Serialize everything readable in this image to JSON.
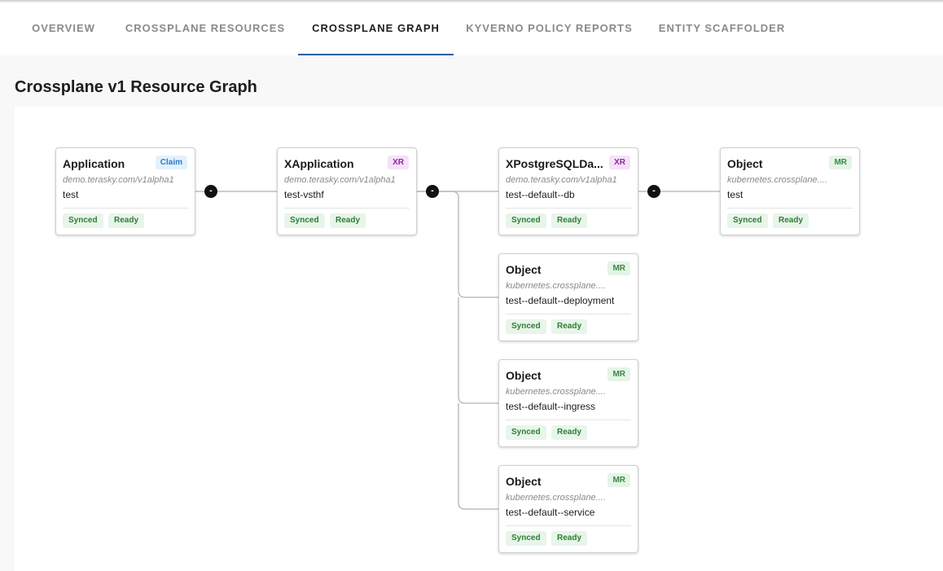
{
  "tabs": [
    {
      "label": "OVERVIEW",
      "active": false
    },
    {
      "label": "CROSSPLANE RESOURCES",
      "active": false
    },
    {
      "label": "CROSSPLANE GRAPH",
      "active": true
    },
    {
      "label": "KYVERNO POLICY REPORTS",
      "active": false
    },
    {
      "label": "ENTITY SCAFFOLDER",
      "active": false
    }
  ],
  "page": {
    "title": "Crossplane v1 Resource Graph"
  },
  "colors": {
    "accent": "#2e5ea8",
    "claim_badge": "#2c7bc9",
    "xr_badge": "#8b2a9e",
    "mr_badge": "#3a8a43",
    "status_text": "#2e7d34"
  },
  "nodes": [
    {
      "kind": "Application",
      "badge": "Claim",
      "api": "demo.terasky.com/v1alpha1",
      "name": "test",
      "synced": "Synced",
      "ready": "Ready",
      "collapse": "-"
    },
    {
      "kind": "XApplication",
      "badge": "XR",
      "api": "demo.terasky.com/v1alpha1",
      "name": "test-vsthf",
      "synced": "Synced",
      "ready": "Ready",
      "collapse": "-"
    },
    {
      "kind": "XPostgreSQLDa...",
      "badge": "XR",
      "api": "demo.terasky.com/v1alpha1",
      "name": "test--default--db",
      "synced": "Synced",
      "ready": "Ready",
      "collapse": "-"
    },
    {
      "kind": "Object",
      "badge": "MR",
      "api": "kubernetes.crossplane....",
      "name": "test",
      "synced": "Synced",
      "ready": "Ready"
    },
    {
      "kind": "Object",
      "badge": "MR",
      "api": "kubernetes.crossplane....",
      "name": "test--default--deployment",
      "synced": "Synced",
      "ready": "Ready"
    },
    {
      "kind": "Object",
      "badge": "MR",
      "api": "kubernetes.crossplane....",
      "name": "test--default--ingress",
      "synced": "Synced",
      "ready": "Ready"
    },
    {
      "kind": "Object",
      "badge": "MR",
      "api": "kubernetes.crossplane....",
      "name": "test--default--service",
      "synced": "Synced",
      "ready": "Ready"
    }
  ]
}
